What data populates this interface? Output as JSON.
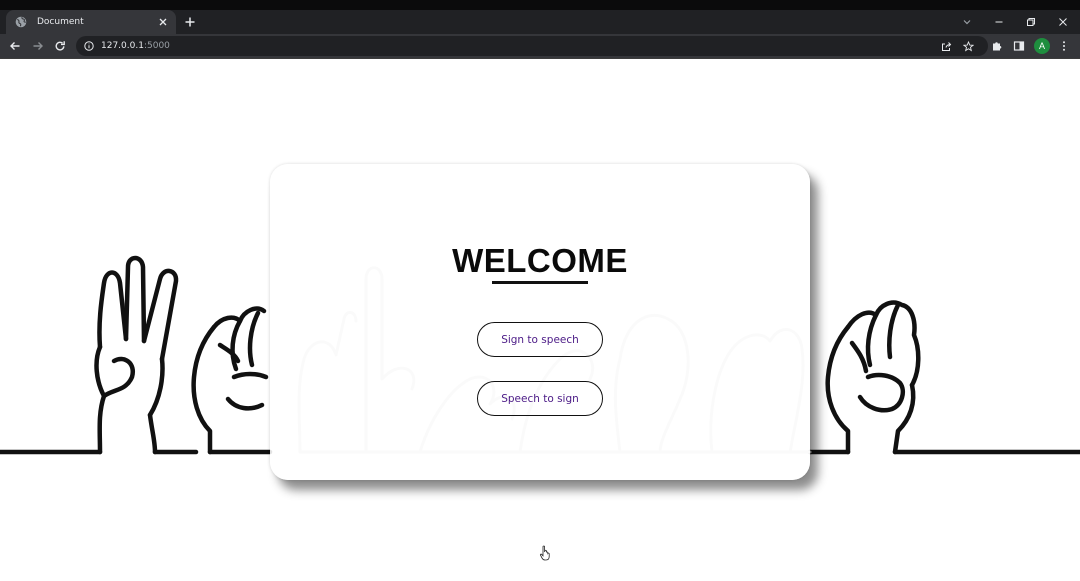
{
  "browser": {
    "tab_title": "Document",
    "url_host": "127.0.0.1",
    "url_port": ":5000",
    "profile_initial": "A"
  },
  "icons": {
    "favicon": "globe-icon",
    "tab_close": "close-icon",
    "new_tab": "plus-icon",
    "tab_search": "chevron-down-icon",
    "minimize": "minimize-icon",
    "restore": "restore-icon",
    "window_close": "close-icon",
    "back": "arrow-left-icon",
    "forward": "arrow-right-icon",
    "reload": "reload-icon",
    "site_info": "info-icon",
    "share": "share-icon",
    "bookmark": "star-icon",
    "extensions": "puzzle-icon",
    "side_panel": "side-panel-icon",
    "menu": "kebab-menu-icon",
    "pointer": "hand-pointer-icon"
  },
  "card": {
    "title": "WELCOME",
    "buttons": [
      {
        "label": "Sign to speech"
      },
      {
        "label": "Speech to sign"
      }
    ]
  },
  "colors": {
    "button_text": "#4b1a86",
    "card_bg": "#ffffff",
    "avatar": "#1e8e3e"
  }
}
